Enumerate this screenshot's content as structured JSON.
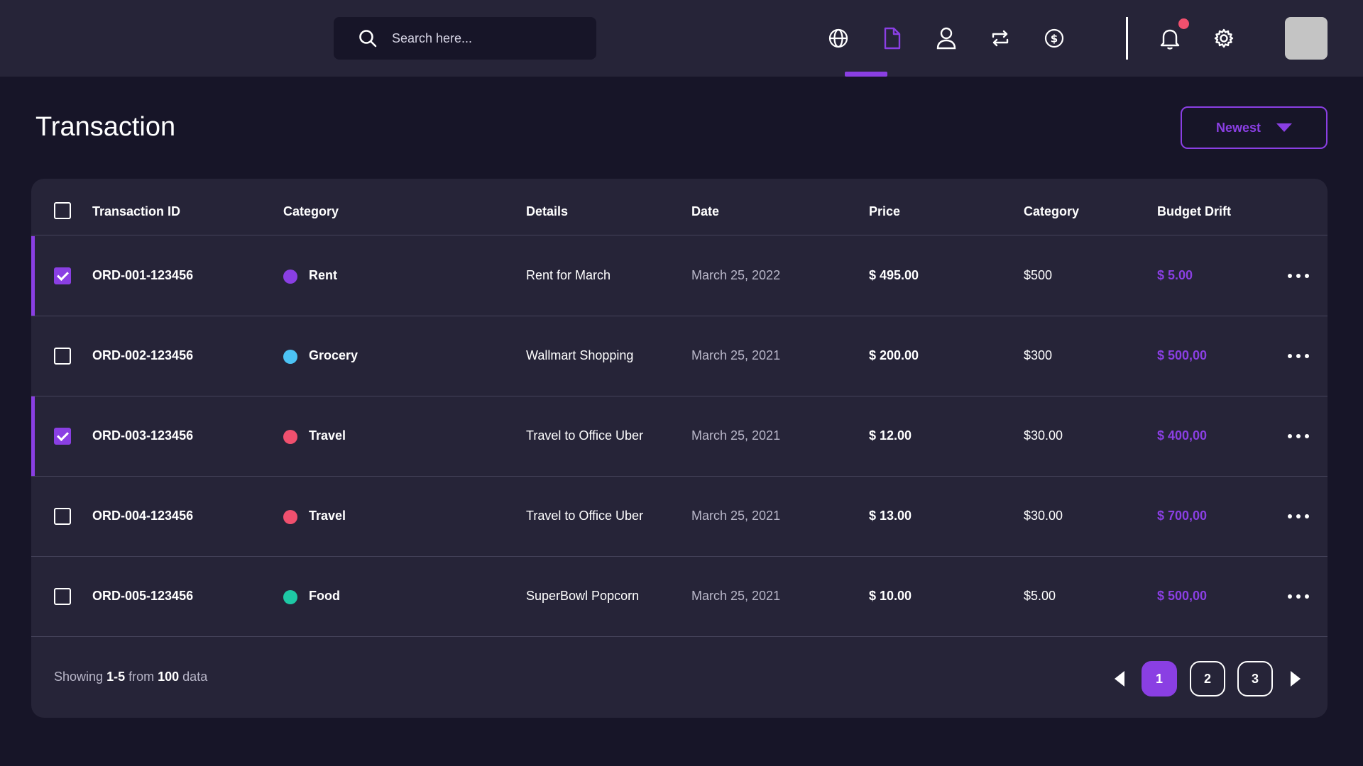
{
  "search": {
    "placeholder": "Search here..."
  },
  "nav": {
    "icons": [
      "globe-icon",
      "document-icon",
      "user-icon",
      "repeat-icon",
      "dollar-icon"
    ],
    "active_index": 1
  },
  "header_actions": {
    "icons": [
      "bell-icon",
      "gear-icon"
    ],
    "has_notification": true
  },
  "page": {
    "title": "Transaction"
  },
  "sort": {
    "label": "Newest"
  },
  "colors": {
    "accent": "#8a3fe3",
    "bg": "#171528",
    "surface": "#262438",
    "notification": "#f0506e"
  },
  "table": {
    "headers": {
      "id": "Transaction ID",
      "category": "Category",
      "details": "Details",
      "date": "Date",
      "price": "Price",
      "budget": "Category",
      "drift": "Budget Drift"
    },
    "rows": [
      {
        "id": "ORD-001-123456",
        "category": "Rent",
        "color": "#8a3fe3",
        "details": "Rent for March",
        "date": "March 25, 2022",
        "price": "$ 495.00",
        "budget": "$500",
        "drift": "$ 5.00",
        "selected": true
      },
      {
        "id": "ORD-002-123456",
        "category": "Grocery",
        "color": "#4cc3f5",
        "details": "Wallmart Shopping",
        "date": "March 25, 2021",
        "price": "$ 200.00",
        "budget": "$300",
        "drift": "$ 500,00",
        "selected": false
      },
      {
        "id": "ORD-003-123456",
        "category": "Travel",
        "color": "#f0506e",
        "details": "Travel to Office Uber",
        "date": "March 25, 2021",
        "price": "$ 12.00",
        "budget": "$30.00",
        "drift": "$ 400,00",
        "selected": true
      },
      {
        "id": "ORD-004-123456",
        "category": "Travel",
        "color": "#f0506e",
        "details": "Travel to Office Uber",
        "date": "March 25, 2021",
        "price": "$ 13.00",
        "budget": "$30.00",
        "drift": "$ 700,00",
        "selected": false
      },
      {
        "id": "ORD-005-123456",
        "category": "Food",
        "color": "#1ec8a5",
        "details": "SuperBowl Popcorn",
        "date": "March 25, 2021",
        "price": "$ 10.00",
        "budget": "$5.00",
        "drift": "$ 500,00",
        "selected": false
      }
    ]
  },
  "footer": {
    "prefix": "Showing",
    "range": "1-5",
    "middle": "from",
    "total": "100",
    "suffix": "data"
  },
  "pagination": {
    "pages": [
      "1",
      "2",
      "3"
    ],
    "active": "1"
  }
}
